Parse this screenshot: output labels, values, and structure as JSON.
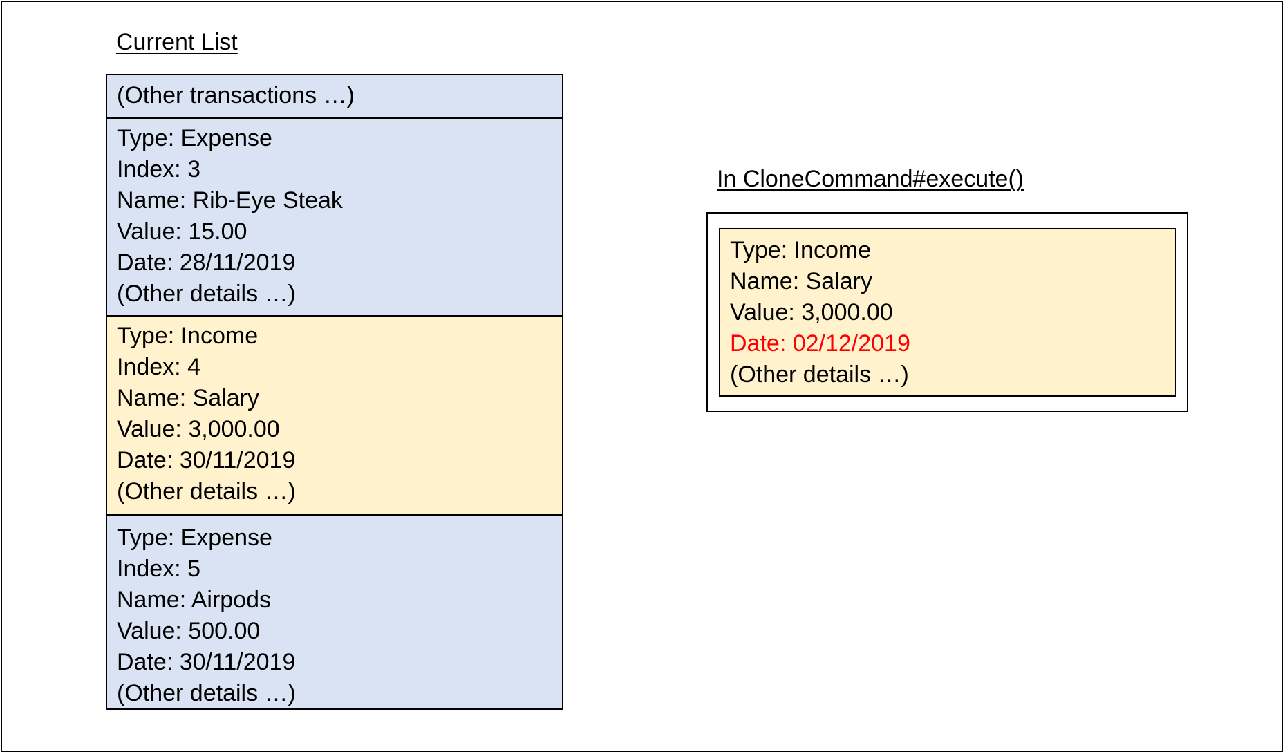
{
  "colors": {
    "expense_fill": "#dae3f3",
    "income_fill": "#fff2cc",
    "highlight_text": "#ff0000",
    "border": "#000000",
    "text": "#000000"
  },
  "current_list": {
    "heading": "Current List",
    "items": [
      {
        "kind": "placeholder",
        "fill": "#dae3f3",
        "lines": [
          "(Other transactions …)"
        ]
      },
      {
        "kind": "expense",
        "fill": "#dae3f3",
        "lines": [
          "Type: Expense",
          "Index: 3",
          "Name: Rib-Eye Steak",
          "Value: 15.00",
          "Date: 28/11/2019",
          "(Other details …)"
        ]
      },
      {
        "kind": "income",
        "fill": "#fff2cc",
        "lines": [
          "Type: Income",
          "Index: 4",
          "Name: Salary",
          "Value: 3,000.00",
          "Date: 30/11/2019",
          "(Other details …)"
        ]
      },
      {
        "kind": "expense",
        "fill": "#dae3f3",
        "lines": [
          "Type: Expense",
          "Index: 5",
          "Name: Airpods",
          "Value: 500.00",
          "Date: 30/11/2019",
          "(Other details …)"
        ]
      }
    ]
  },
  "clone_command": {
    "heading": "In CloneCommand#execute()",
    "item": {
      "fill": "#fff2cc",
      "type_line": "Type: Income",
      "name_line": "Name: Salary",
      "value_line": "Value: 3,000.00",
      "date_line": "Date: 02/12/2019",
      "other_line": "(Other details …)"
    }
  }
}
